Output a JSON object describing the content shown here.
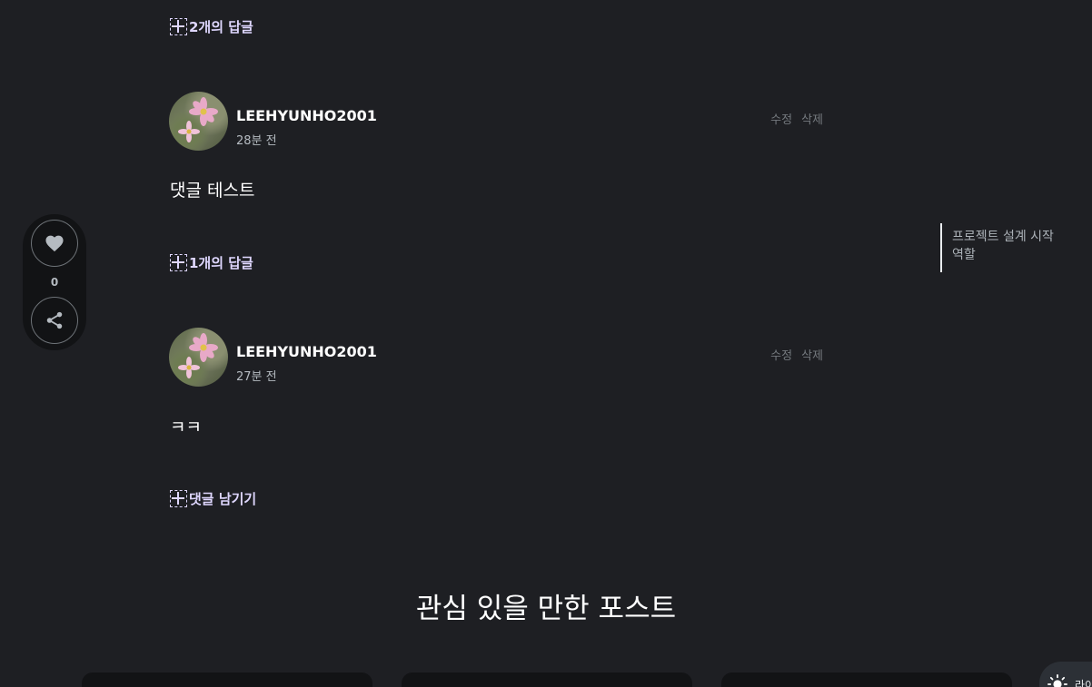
{
  "replies_top": {
    "label": "2개의 답글"
  },
  "comments": [
    {
      "username": "LEEHYUNHO2001",
      "time": "28분 전",
      "edit_label": "수정",
      "delete_label": "삭제",
      "body": "댓글 테스트",
      "reply_label": "1개의 답글"
    },
    {
      "username": "LEEHYUNHO2001",
      "time": "27분 전",
      "edit_label": "수정",
      "delete_label": "삭제",
      "body": "ㅋㅋ"
    }
  ],
  "write_comment": {
    "label": "댓글 남기기"
  },
  "like_widget": {
    "count": "0",
    "icons": [
      "heart-icon",
      "share-icon"
    ]
  },
  "toc": {
    "items": [
      "프로젝트 설계 시작",
      "역할"
    ]
  },
  "recommend": {
    "title": "관심 있을 만한 포스트"
  },
  "theme_toggle": {
    "icon": "sun-icon",
    "label": "라이트"
  },
  "colors": {
    "background": "#1e1f23",
    "accent_reply": "#dfd7ff",
    "card": "#121315"
  }
}
